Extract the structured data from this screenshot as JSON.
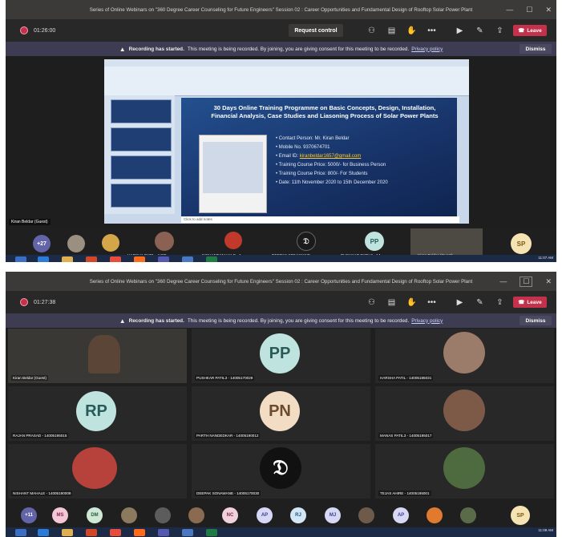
{
  "meeting_title": "Series of Online Webinars on \"360 Degree Career Counseling for Future Engineers\" Session 02 : Career Opportunities and Fundamental Design of Rooftop Solar Power Plant",
  "top": {
    "timer": "01:26:00",
    "request_control": "Request control",
    "leave": "Leave",
    "banner_bold": "Recording has started.",
    "banner_text": "This meeting is being recorded. By joining, you are giving consent for this meeting to be recorded.",
    "privacy_link": "Privacy policy",
    "dismiss": "Dismiss",
    "presenter_tag": "Kiran Beldar (Guest)",
    "ppt_title": "30 Days Online Training Programme on Basic Concepts, Design, Installation, Financial Analysis, Case Studies and Liasoning Process of Solar Power Plants",
    "ppt_notes": "Click to add notes",
    "bullets": [
      "Contact Person: Mr. Kiran Beldar",
      "Mobile No. 9370674701",
      "Training Course Price: 5000/- for Business Person",
      "Training Course Price: 800/- For Students",
      "Date: 11th November 2020 to 15th December 2020"
    ],
    "email_label": "Email ID:",
    "email_value": "kiranbeldar1657@gmail.com",
    "overflow_count": "+27",
    "participants": [
      {
        "label": "HARSHA PATIL - 1400..."
      },
      {
        "label": "NISHANT MAHALE - 1..."
      },
      {
        "label": "DEEPAK SONAWANE ..."
      },
      {
        "label": "PUSHKAR PATIL3 - 14..."
      },
      {
        "label": "Kiran Beldar (Guest)"
      }
    ],
    "pp_initials": "PP",
    "sp_initials": "SP",
    "clock_time": "11:07 AM"
  },
  "bottom": {
    "timer": "01:27:38",
    "leave": "Leave",
    "banner_bold": "Recording has started.",
    "banner_text": "This meeting is being recorded. By joining, you are giving consent for this meeting to be recorded.",
    "privacy_link": "Privacy policy",
    "dismiss": "Dismiss",
    "tiles": [
      {
        "label": "Kiran Beldar (Guest)",
        "initials": ""
      },
      {
        "label": "PUSHKAR PATIL3 - 14005170029",
        "initials": "PP"
      },
      {
        "label": "HARSHA PATIL - 14005185031",
        "initials": ""
      },
      {
        "label": "RAJAN PRASAD - 14005195015",
        "initials": "RP"
      },
      {
        "label": "PARTH NANDEDKAR - 14005190012",
        "initials": "PN"
      },
      {
        "label": "MANAS PATIL3 - 14005195017",
        "initials": ""
      },
      {
        "label": "NISHANT MAHALE - 14005190009",
        "initials": ""
      },
      {
        "label": "DEEPAK SONAWANE - 14005170030",
        "initials": ""
      },
      {
        "label": "TEJAS AHIRE - 14005195001",
        "initials": ""
      }
    ],
    "overflow_count": "+11",
    "roster_initials": [
      "MS",
      "DM",
      "NC",
      "AP",
      "RJ",
      "MJ",
      "AP"
    ],
    "sp_initials": "SP",
    "clock_time": "11:09 AM"
  },
  "colors": {
    "teams_bg": "#201f1f",
    "leave_red": "#c4314b",
    "banner_bg": "#3d3c52",
    "avatar_bg": "#bfe4e0",
    "avatar_text": "#2a5a58",
    "sp_bg": "#f5e3b3"
  }
}
